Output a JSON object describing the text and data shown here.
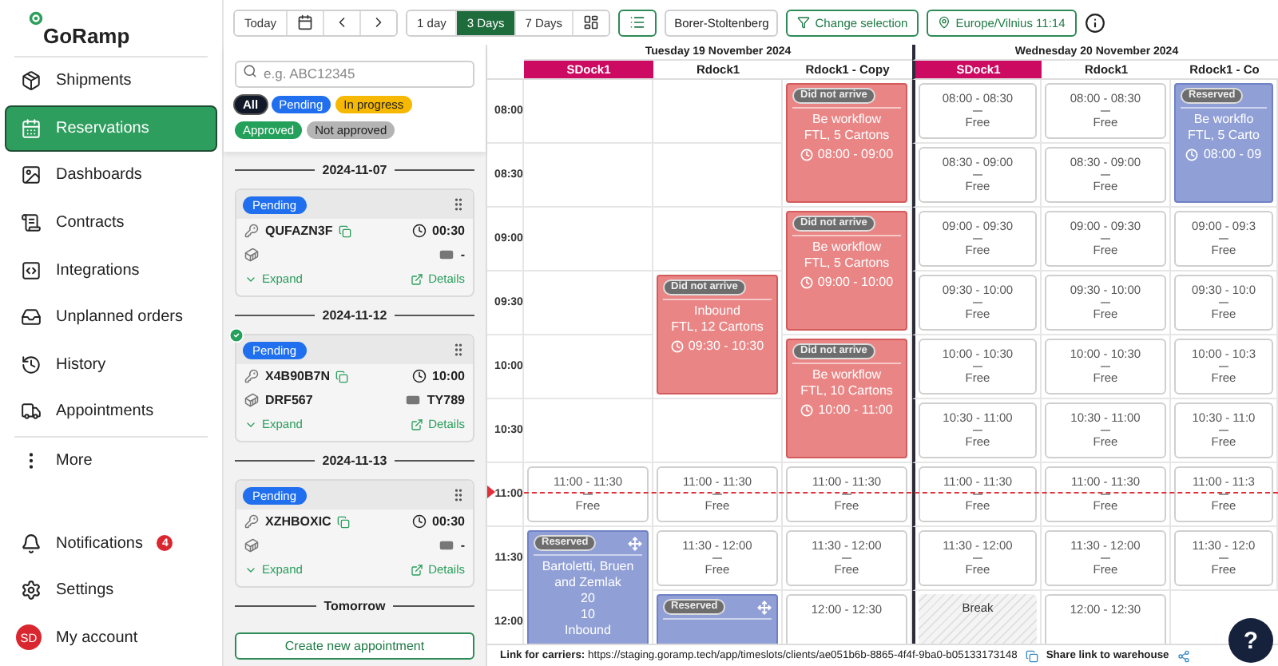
{
  "sidebar": {
    "logo": "GoRamp",
    "items": [
      {
        "label": "Shipments",
        "selected": false
      },
      {
        "label": "Reservations",
        "selected": true
      },
      {
        "label": "Dashboards",
        "selected": false
      },
      {
        "label": "Contracts",
        "selected": false
      },
      {
        "label": "Integrations",
        "selected": false
      },
      {
        "label": "Unplanned orders",
        "selected": false
      },
      {
        "label": "History",
        "selected": false
      },
      {
        "label": "Appointments",
        "selected": false
      }
    ],
    "more": "More",
    "bottom_items": [
      {
        "label": "Notifications",
        "badge": "4"
      },
      {
        "label": "Settings"
      },
      {
        "label": "My account",
        "avatar": "SD"
      }
    ]
  },
  "toolbar": {
    "today": "Today",
    "views": [
      {
        "label": "1 day",
        "selected": false
      },
      {
        "label": "3 Days",
        "selected": true
      },
      {
        "label": "7 Days",
        "selected": false
      }
    ],
    "warehouse": "Borer-Stoltenberg",
    "change_selection": "Change selection",
    "timezone": "Europe/Vilnius 11:14"
  },
  "panel": {
    "search": {
      "placeholder": "e.g. ABC12345"
    },
    "filters": [
      {
        "label": "All",
        "color": "#111827",
        "selected": true
      },
      {
        "label": "Pending",
        "color": "#1f6fef",
        "selected": false
      },
      {
        "label": "In progress",
        "color": "#f6b800",
        "selected": false
      },
      {
        "label": "Approved",
        "color": "#23a05a",
        "selected": false
      },
      {
        "label": "Not approved",
        "color": "#b4b4b4",
        "selected": false
      }
    ],
    "groups": [
      {
        "date": "2024-11-07",
        "cards": [
          {
            "status": "Pending",
            "code": "QUFAZN3F",
            "duration": "00:30",
            "plate": "-",
            "verified": false,
            "expand": "Expand",
            "details": "Details"
          }
        ]
      },
      {
        "date": "2024-11-12",
        "cards": [
          {
            "status": "Pending",
            "code": "X4B90B7N",
            "duration": "10:00",
            "trailer": "DRF567",
            "plate": "TY789",
            "verified": true,
            "expand": "Expand",
            "details": "Details"
          }
        ]
      },
      {
        "date": "2024-11-13",
        "cards": [
          {
            "status": "Pending",
            "code": "XZHBOXIC",
            "duration": "00:30",
            "plate": "-",
            "verified": false,
            "expand": "Expand",
            "details": "Details"
          }
        ]
      },
      {
        "date": "Tomorrow"
      }
    ],
    "create_button": "Create new appointment"
  },
  "calendar": {
    "times": [
      "08:00",
      "08:30",
      "09:00",
      "09:30",
      "10:00",
      "10:30",
      "11:00",
      "11:30",
      "12:00"
    ],
    "days": [
      {
        "title": "Tuesday 19 November 2024",
        "docks": [
          {
            "name": "SDock1",
            "color": "#cc0a62",
            "slots": [
              {
                "kind": "empty"
              },
              {
                "kind": "empty"
              },
              {
                "kind": "empty"
              },
              {
                "kind": "empty"
              },
              {
                "kind": "empty"
              },
              {
                "kind": "empty"
              },
              {
                "kind": "free",
                "time": "11:00 - 11:30",
                "label": "Free"
              },
              {
                "kind": "reserved",
                "status": "Reserved",
                "movable": true,
                "lines": [
                  "Bartoletti, Bruen and Zemlak",
                  "20",
                  "10",
                  "Inbound"
                ]
              }
            ]
          },
          {
            "name": "Rdock1",
            "slots": [
              {
                "kind": "empty"
              },
              {
                "kind": "empty"
              },
              {
                "kind": "empty"
              },
              {
                "kind": "missed",
                "status": "Did not arrive",
                "lines": [
                  "Inbound",
                  "FTL, 12 Cartons"
                ],
                "time": "09:30 - 10:30"
              },
              {
                "kind": "empty"
              },
              {
                "kind": "free",
                "time": "11:00 - 11:30",
                "label": "Free"
              },
              {
                "kind": "free",
                "time": "11:30 - 12:00",
                "label": "Free"
              },
              {
                "kind": "reserved",
                "status": "Reserved",
                "movable": true
              }
            ]
          },
          {
            "name": "Rdock1 - Copy",
            "slots": [
              {
                "kind": "missed",
                "status": "Did not arrive",
                "lines": [
                  "Be workflow",
                  "FTL, 5 Cartons"
                ],
                "time": "08:00 - 09:00"
              },
              {
                "kind": "missed",
                "status": "Did not arrive",
                "lines": [
                  "Be workflow",
                  "FTL, 5 Cartons"
                ],
                "time": "09:00 - 10:00"
              },
              {
                "kind": "missed",
                "status": "Did not arrive",
                "lines": [
                  "Be workflow",
                  "FTL, 10 Cartons"
                ],
                "time": "10:00 - 11:00"
              },
              {
                "kind": "free",
                "time": "11:00 - 11:30",
                "label": "Free"
              },
              {
                "kind": "free",
                "time": "11:30 - 12:00",
                "label": "Free"
              },
              {
                "kind": "free",
                "time": "12:00 - 12:30"
              }
            ]
          }
        ]
      },
      {
        "title": "Wednesday 20 November 2024",
        "docks": [
          {
            "name": "SDock1",
            "color": "#cc0a62",
            "slots": [
              {
                "kind": "free",
                "time": "08:00 - 08:30",
                "label": "Free"
              },
              {
                "kind": "free",
                "time": "08:30 - 09:00",
                "label": "Free"
              },
              {
                "kind": "free",
                "time": "09:00 - 09:30",
                "label": "Free"
              },
              {
                "kind": "free",
                "time": "09:30 - 10:00",
                "label": "Free"
              },
              {
                "kind": "free",
                "time": "10:00 - 10:30",
                "label": "Free"
              },
              {
                "kind": "free",
                "time": "10:30 - 11:00",
                "label": "Free"
              },
              {
                "kind": "free",
                "time": "11:00 - 11:30",
                "label": "Free"
              },
              {
                "kind": "free",
                "time": "11:30 - 12:00",
                "label": "Free"
              },
              {
                "kind": "break",
                "label": "Break"
              }
            ]
          },
          {
            "name": "Rdock1",
            "slots": [
              {
                "kind": "free",
                "time": "08:00 - 08:30",
                "label": "Free"
              },
              {
                "kind": "free",
                "time": "08:30 - 09:00",
                "label": "Free"
              },
              {
                "kind": "free",
                "time": "09:00 - 09:30",
                "label": "Free"
              },
              {
                "kind": "free",
                "time": "09:30 - 10:00",
                "label": "Free"
              },
              {
                "kind": "free",
                "time": "10:00 - 10:30",
                "label": "Free"
              },
              {
                "kind": "free",
                "time": "10:30 - 11:00",
                "label": "Free"
              },
              {
                "kind": "free",
                "time": "11:00 - 11:30",
                "label": "Free"
              },
              {
                "kind": "free",
                "time": "11:30 - 12:00",
                "label": "Free"
              },
              {
                "kind": "free",
                "time": "12:00 - 12:30"
              }
            ]
          },
          {
            "name": "Rdock1 - Co",
            "slots": [
              {
                "kind": "reserved",
                "status": "Reserved",
                "lines": [
                  "Be workflo",
                  "FTL, 5 Carto"
                ],
                "time": "08:00 - 09"
              },
              {
                "kind": "free",
                "time": "09:00 - 09:3",
                "label": "Free"
              },
              {
                "kind": "free",
                "time": "09:30 - 10:0",
                "label": "Free"
              },
              {
                "kind": "free",
                "time": "10:00 - 10:3",
                "label": "Free"
              },
              {
                "kind": "free",
                "time": "10:30 - 11:0",
                "label": "Free"
              },
              {
                "kind": "free",
                "time": "11:00 - 11:3",
                "label": "Free"
              },
              {
                "kind": "free",
                "time": "11:30 - 12:0",
                "label": "Free"
              }
            ]
          }
        ]
      }
    ]
  },
  "footer": {
    "carrier_link": "**Link for carriers:** https://staging.goramp.tech/app/timeslots/clients/ae051b6b-8865-4f4f-9ba0-b05133173148",
    "share": "Share link to warehouse"
  },
  "help": "?"
}
